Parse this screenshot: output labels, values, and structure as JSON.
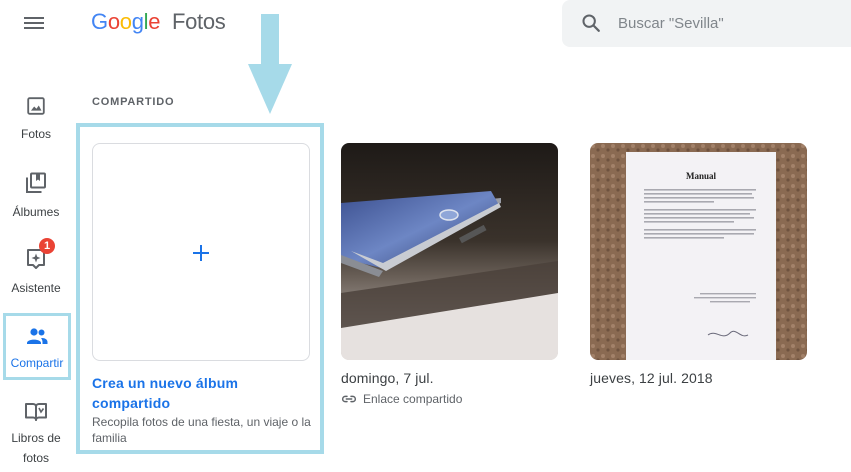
{
  "header": {
    "logo_word": [
      "G",
      "o",
      "o",
      "g",
      "l",
      "e"
    ],
    "logo_colors": [
      "#4285f4",
      "#ea4335",
      "#fbbc05",
      "#4285f4",
      "#34a853",
      "#ea4335"
    ],
    "product": "Fotos",
    "search_placeholder": "Buscar \"Sevilla\""
  },
  "sidebar": {
    "items": [
      {
        "label": "Fotos",
        "icon": "photo-icon"
      },
      {
        "label": "Álbumes",
        "icon": "albums-icon"
      },
      {
        "label": "Asistente",
        "icon": "assistant-icon",
        "badge": "1"
      },
      {
        "label": "Compartir",
        "icon": "people-icon",
        "active": true
      },
      {
        "label": "Libros de fotos",
        "label_lines": [
          "Libros de",
          "fotos"
        ],
        "icon": "book-icon"
      }
    ]
  },
  "main": {
    "section_title": "COMPARTIDO",
    "new_album": {
      "title": "Crea un nuevo álbum compartido",
      "description": "Recopila fotos de una fiesta, un viaje o la familia"
    },
    "albums": [
      {
        "date": "domingo, 7 jul.",
        "subtitle": "Enlace compartido",
        "subtitle_icon": "link-icon"
      },
      {
        "date": "jueves, 12 jul. 2018"
      }
    ],
    "document_photo_title": "Manual"
  },
  "colors": {
    "accent": "#1a73e8",
    "highlight": "#a6dae9",
    "badge": "#ea4335",
    "search_bg": "#f1f3f4"
  }
}
